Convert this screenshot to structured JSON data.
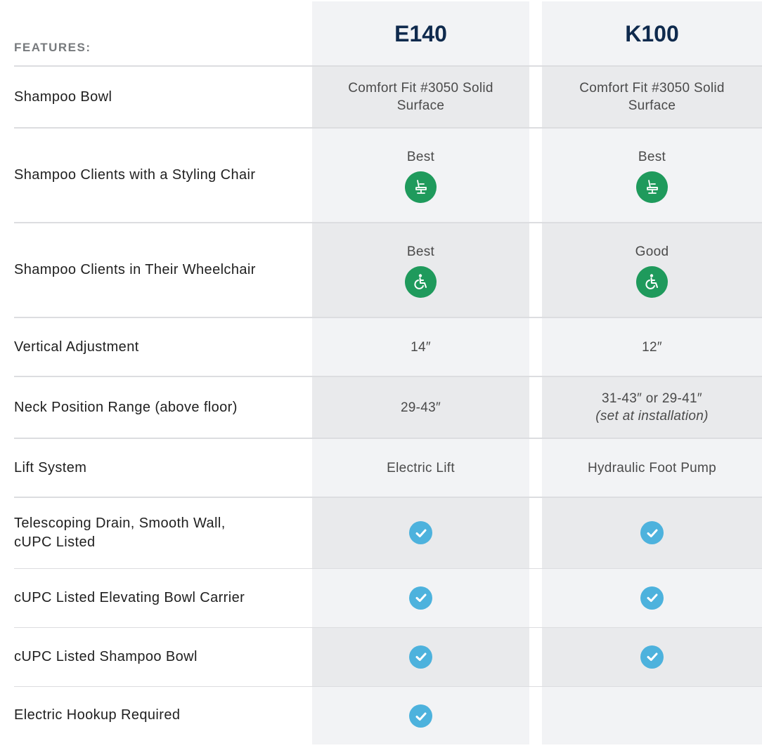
{
  "header": {
    "features_label": "FEATURES:",
    "products": [
      "E140",
      "K100"
    ]
  },
  "rows": [
    {
      "feature": "Shampoo Bowl",
      "e140": "Comfort Fit #3050 Solid Surface",
      "k100": "Comfort Fit #3050 Solid Surface"
    },
    {
      "feature": "Shampoo Clients with a Styling Chair",
      "e140": "Best",
      "k100": "Best",
      "icon": "styling-chair-icon"
    },
    {
      "feature": "Shampoo Clients in Their Wheelchair",
      "e140": "Best",
      "k100": "Good",
      "icon": "wheelchair-icon"
    },
    {
      "feature": "Vertical Adjustment",
      "e140": "14″",
      "k100": "12″"
    },
    {
      "feature": "Neck Position Range (above floor)",
      "e140": "29-43″",
      "k100": "31-43″ or 29-41″",
      "k100_note": "(set at installation)"
    },
    {
      "feature": "Lift System",
      "e140": "Electric Lift",
      "k100": "Hydraulic Foot Pump"
    },
    {
      "feature": "Telescoping Drain, Smooth Wall, cUPC Listed",
      "e140_check": true,
      "k100_check": true
    },
    {
      "feature": "cUPC Listed Elevating Bowl Carrier",
      "e140_check": true,
      "k100_check": true
    },
    {
      "feature": "cUPC Listed Shampoo Bowl",
      "e140_check": true,
      "k100_check": true
    },
    {
      "feature": "Electric Hookup Required",
      "e140_check": true,
      "k100_check": false
    }
  ],
  "colors": {
    "title": "#0f2a4d",
    "icon_green": "#1f9a5c",
    "check_blue": "#4db2dd",
    "column_bg": "#f2f3f5",
    "column_shade": "#e9eaec"
  }
}
